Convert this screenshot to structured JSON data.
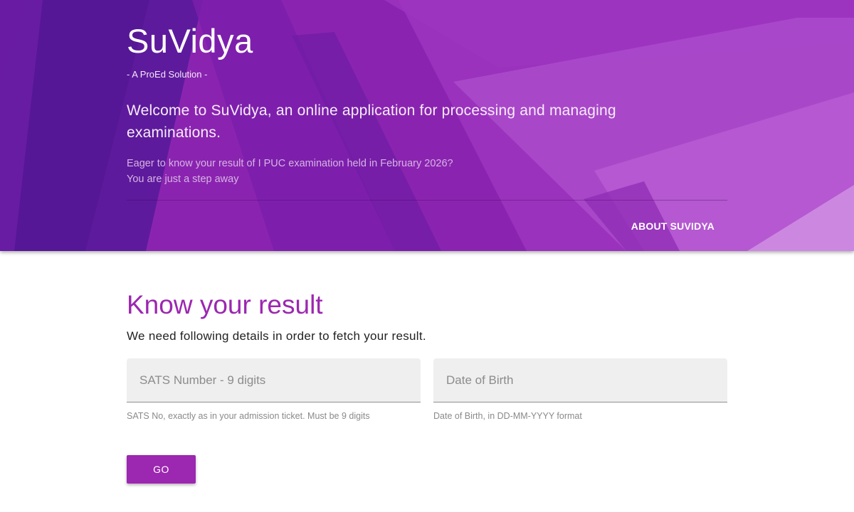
{
  "header": {
    "brand": "SuVidya",
    "tagline": "- A ProEd Solution -",
    "welcome": "Welcome to SuVidya, an online application for processing and managing examinations.",
    "eager_line1": "Eager to know your result of I PUC examination held in February 2026?",
    "eager_line2": "You are just a step away",
    "about_link": "ABOUT SUVIDYA"
  },
  "form": {
    "heading": "Know your result",
    "intro": "We need following details in order to fetch your result.",
    "sats": {
      "placeholder": "SATS Number - 9 digits",
      "value": "",
      "helper": "SATS No, exactly as in your admission ticket. Must be 9 digits"
    },
    "dob": {
      "placeholder": "Date of Birth",
      "value": "",
      "helper": "Date of Birth, in DD-MM-YYYY format"
    },
    "submit_label": "GO"
  },
  "colors": {
    "accent": "#9c27b0",
    "hero_base": "#8a24b0",
    "input_bg": "#efefef"
  }
}
